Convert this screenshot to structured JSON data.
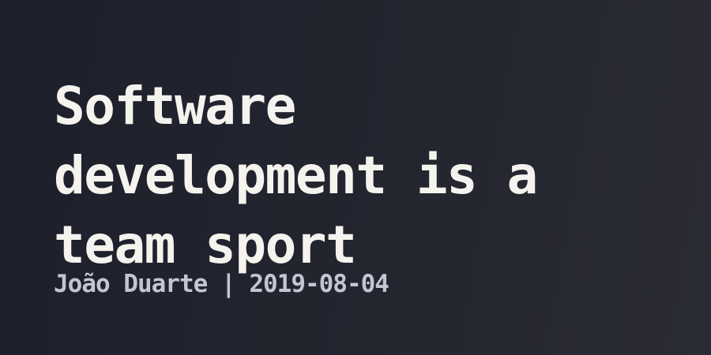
{
  "post": {
    "title_lines": [
      "Software",
      "development is a",
      "team sport"
    ],
    "author": "João Duarte",
    "separator": "|",
    "date": "2019-08-04"
  }
}
